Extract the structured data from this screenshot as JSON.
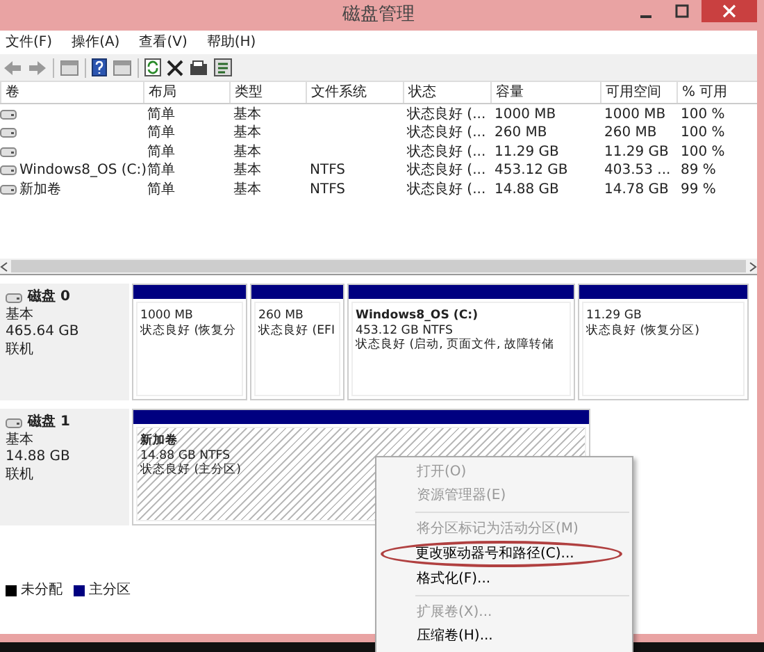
{
  "window": {
    "title": "磁盘管理"
  },
  "menu_bar": [
    "文件(F)",
    "操作(A)",
    "查看(V)",
    "帮助(H)"
  ],
  "volume_table": {
    "columns": [
      "卷",
      "布局",
      "类型",
      "文件系统",
      "状态",
      "容量",
      "可用空间",
      "% 可用"
    ],
    "rows": [
      {
        "layout": "简单",
        "type": "基本",
        "status": "状态良好 (...",
        "capacity": "1000 MB",
        "free_space": "1000 MB",
        "percent_free": "100 %"
      },
      {
        "layout": "简单",
        "type": "基本",
        "status": "状态良好 (...",
        "capacity": "260 MB",
        "free_space": "260 MB",
        "percent_free": "100 %"
      },
      {
        "layout": "简单",
        "type": "基本",
        "status": "状态良好 (...",
        "capacity": "11.29 GB",
        "free_space": "11.29 GB",
        "percent_free": "100 %"
      },
      {
        "volume": "Windows8_OS (C:)",
        "layout": "简单",
        "type": "基本",
        "file_system": "NTFS",
        "status": "状态良好 (...",
        "capacity": "453.12 GB",
        "free_space": "403.53 ...",
        "percent_free": "89 %"
      },
      {
        "volume": "新加卷",
        "layout": "简单",
        "type": "基本",
        "file_system": "NTFS",
        "status": "状态良好 (...",
        "capacity": "14.88 GB",
        "free_space": "14.78 GB",
        "percent_free": "99 %"
      }
    ]
  },
  "disks": [
    {
      "name": "磁盘 0",
      "kind": "基本",
      "size": "465.64 GB",
      "state": "联机",
      "partitions": [
        {
          "size": "1000 MB",
          "status": "状态良好 (恢复分",
          "selected": false
        },
        {
          "size": "260 MB",
          "status": "状态良好 (EFI",
          "selected": false
        },
        {
          "name": "Windows8_OS  (C:)",
          "size": "453.12 GB NTFS",
          "status": "状态良好 (启动, 页面文件, 故障转储",
          "selected": false
        },
        {
          "size": "11.29 GB",
          "status": "状态良好 (恢复分区)",
          "selected": false
        }
      ]
    },
    {
      "name": "磁盘 1",
      "kind": "基本",
      "size": "14.88 GB",
      "state": "联机",
      "partitions": [
        {
          "name": "新加卷",
          "size": "14.88 GB NTFS",
          "status": "状态良好 (主分区)",
          "selected": true
        }
      ]
    }
  ],
  "legend": [
    {
      "label": "未分配",
      "color": "#000000"
    },
    {
      "label": "主分区",
      "color": "#000080"
    }
  ],
  "context_menu": [
    {
      "kind": "item",
      "label": "打开(O)",
      "disabled": true,
      "circled": false
    },
    {
      "kind": "item",
      "label": "资源管理器(E)",
      "disabled": true,
      "circled": false
    },
    {
      "kind": "separator"
    },
    {
      "kind": "item",
      "label": "将分区标记为活动分区(M)",
      "disabled": true,
      "circled": false
    },
    {
      "kind": "item",
      "label": "更改驱动器号和路径(C)...",
      "disabled": false,
      "circled": true
    },
    {
      "kind": "item",
      "label": "格式化(F)...",
      "disabled": false,
      "circled": false
    },
    {
      "kind": "separator"
    },
    {
      "kind": "item",
      "label": "扩展卷(X)...",
      "disabled": true,
      "circled": false
    },
    {
      "kind": "item",
      "label": "压缩卷(H)...",
      "disabled": false,
      "circled": false
    }
  ]
}
